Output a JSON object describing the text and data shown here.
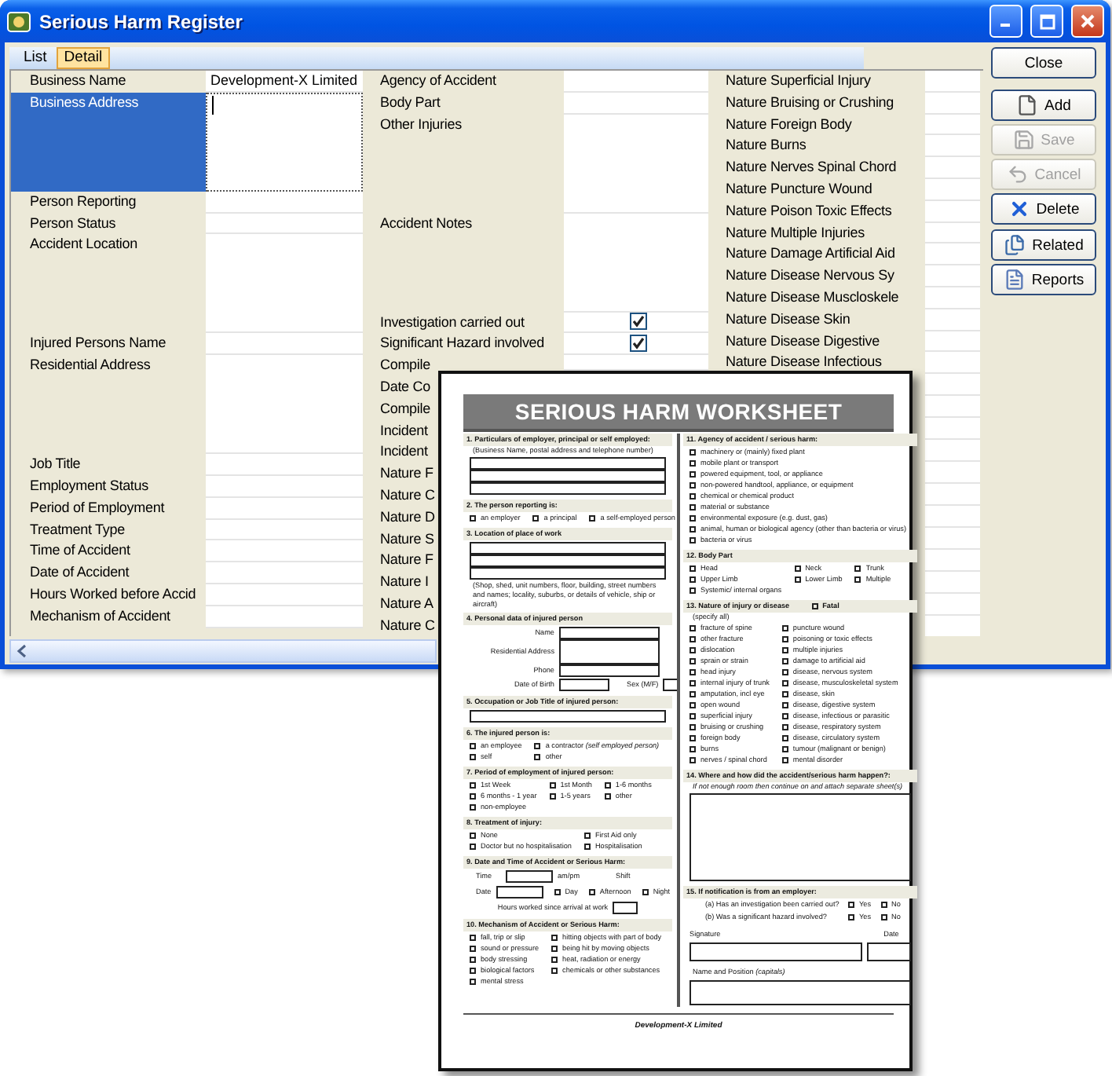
{
  "window": {
    "title": "Serious Harm Register"
  },
  "tabs": [
    {
      "label": "List",
      "selected": false
    },
    {
      "label": "Detail",
      "selected": true
    }
  ],
  "columns": [
    {
      "fields": [
        {
          "label": "Business Name",
          "value": "Development-X Limited",
          "kind": "text",
          "selected": false
        },
        {
          "label": "Business Address",
          "kind": "multiline",
          "selected": true
        },
        {
          "label": "Person Reporting",
          "kind": "text",
          "selected": false
        },
        {
          "label": "Person Status",
          "kind": "text",
          "selected": false
        },
        {
          "label": "Accident Location",
          "kind": "multiline",
          "selected": false
        },
        {
          "label": "Injured Persons Name",
          "kind": "text",
          "selected": false
        },
        {
          "label": "Residential Address",
          "kind": "multiline",
          "selected": false
        },
        {
          "label": "Job Title",
          "kind": "text",
          "selected": false
        },
        {
          "label": "Employment Status",
          "kind": "text",
          "selected": false
        },
        {
          "label": "Period of Employment",
          "kind": "text",
          "selected": false
        },
        {
          "label": "Treatment Type",
          "kind": "text",
          "selected": false
        },
        {
          "label": "Time of Accident",
          "kind": "text",
          "selected": false
        },
        {
          "label": "Date of Accident",
          "kind": "text",
          "selected": false
        },
        {
          "label": "Hours Worked before Accid",
          "kind": "text",
          "selected": false
        },
        {
          "label": "Mechanism of Accident",
          "kind": "text",
          "selected": false
        }
      ]
    },
    {
      "fields": [
        {
          "label": "Agency of Accident",
          "kind": "text"
        },
        {
          "label": "Body Part",
          "kind": "text"
        },
        {
          "label": "Other Injuries",
          "kind": "multiline"
        },
        {
          "label": "Accident Notes",
          "kind": "multiline"
        },
        {
          "label": "Investigation carried out",
          "kind": "checkbox",
          "checked": true
        },
        {
          "label": "Significant Hazard involved",
          "kind": "checkbox",
          "checked": true
        },
        {
          "label": "Compile",
          "kind": "text"
        },
        {
          "label": "Date Co",
          "kind": "text"
        },
        {
          "label": "Compile",
          "kind": "text"
        },
        {
          "label": "Incident",
          "kind": "text"
        },
        {
          "label": "Incident",
          "kind": "text"
        },
        {
          "label": "Nature F",
          "kind": "text"
        },
        {
          "label": "Nature C",
          "kind": "text"
        },
        {
          "label": "Nature D",
          "kind": "text"
        },
        {
          "label": "Nature S",
          "kind": "text"
        },
        {
          "label": "Nature F",
          "kind": "text"
        },
        {
          "label": "Nature I",
          "kind": "text"
        },
        {
          "label": "Nature A",
          "kind": "text"
        },
        {
          "label": "Nature C",
          "kind": "text"
        }
      ]
    },
    {
      "fields": [
        {
          "label": "Nature Superficial Injury",
          "kind": "text"
        },
        {
          "label": "Nature Bruising or Crushing",
          "kind": "text"
        },
        {
          "label": "Nature Foreign Body",
          "kind": "text"
        },
        {
          "label": "Nature Burns",
          "kind": "text"
        },
        {
          "label": "Nature Nerves Spinal Chord",
          "kind": "text"
        },
        {
          "label": "Nature Puncture Wound",
          "kind": "text"
        },
        {
          "label": "Nature Poison Toxic Effects",
          "kind": "text"
        },
        {
          "label": "Nature Multiple Injuries",
          "kind": "text"
        },
        {
          "label": "Nature Damage Artificial Aid",
          "kind": "text"
        },
        {
          "label": "Nature Disease Nervous Sy",
          "kind": "text"
        },
        {
          "label": "Nature Disease Muscloskele",
          "kind": "text"
        },
        {
          "label": "Nature Disease Skin",
          "kind": "text"
        },
        {
          "label": "Nature Disease Digestive",
          "kind": "text"
        },
        {
          "label": "Nature Disease Infectious",
          "kind": "text"
        }
      ]
    }
  ],
  "buttons": [
    {
      "label": "Close",
      "disabled": false
    },
    {
      "label": "Add",
      "disabled": false
    },
    {
      "label": "Save",
      "disabled": true
    },
    {
      "label": "Cancel",
      "disabled": true
    },
    {
      "label": "Delete",
      "disabled": false
    },
    {
      "label": "Related",
      "disabled": false
    },
    {
      "label": "Reports",
      "disabled": false
    }
  ],
  "worksheet": {
    "title": "SERIOUS HARM WORKSHEET",
    "left_sections": [
      {
        "kind": "boxes",
        "heading": "1. Particulars of employer, principal or self employed:",
        "note": "(Business Name, postal address and telephone number)"
      },
      {
        "kind": "options",
        "heading": "2. The person reporting is:",
        "rows": [
          [
            "an employer",
            "a principal",
            "a self-employed person"
          ]
        ]
      },
      {
        "kind": "boxes",
        "heading": "3. Location of place of work",
        "after_note": "(Shop, shed, unit numbers, floor, building, street numbers and names; locality, suburbs, or details of vehicle, ship or aircraft)"
      },
      {
        "kind": "person",
        "heading": "4. Personal data of injured person",
        "fields": [
          {
            "label": "Name",
            "kind": "line"
          },
          {
            "label": "Residential Address",
            "kind": "tall"
          },
          {
            "label": "Phone",
            "kind": "line"
          }
        ],
        "dob": "Date of Birth",
        "sex": "Sex (M/F)"
      },
      {
        "kind": "box",
        "heading": "5. Occupation or Job Title of injured person:"
      },
      {
        "kind": "options",
        "heading": "6. The injured person is:",
        "rows": [
          [
            "an employee",
            "a contractor *(self employed person)*"
          ],
          [
            "self",
            "other"
          ]
        ]
      },
      {
        "kind": "options",
        "heading": "7. Period of employment of injured person:",
        "rows": [
          [
            "1st Week",
            "1st Month",
            "1-6 months"
          ],
          [
            "6 months - 1 year",
            "1-5 years",
            "other"
          ],
          [
            "non-employee"
          ]
        ]
      },
      {
        "kind": "options",
        "heading": "8. Treatment of injury:",
        "rows": [
          [
            "None",
            "First Aid only"
          ],
          [
            "Doctor but no hospitalisation",
            "Hospitalisation"
          ]
        ]
      },
      {
        "kind": "datetime",
        "heading": "9. Date and Time of Accident or Serious Harm:",
        "time": "Time",
        "ampm": "am/pm",
        "shift": "Shift",
        "date": "Date",
        "shifts": [
          "Day",
          "Afternoon",
          "Night"
        ],
        "hours": "Hours worked since arrival at work"
      },
      {
        "kind": "options",
        "heading": "10. Mechanism of Accident or Serious Harm:",
        "rows": [
          [
            "fall, trip or slip",
            "hitting objects with part of body"
          ],
          [
            "sound or pressure",
            "being hit by moving objects"
          ],
          [
            "body stressing",
            "heat, radiation or energy"
          ],
          [
            "biological factors",
            "chemicals or other substances"
          ],
          [
            "mental stress"
          ]
        ]
      }
    ],
    "right_sections": [
      {
        "kind": "options",
        "heading": "11. Agency of accident / serious harm:",
        "rows": [
          [
            "machinery or (mainly) fixed plant"
          ],
          [
            "mobile plant or transport"
          ],
          [
            "powered equipment, tool, or appliance"
          ],
          [
            "non-powered handtool, appliance, or equipment"
          ],
          [
            "chemical or chemical product"
          ],
          [
            "material or substance"
          ],
          [
            "environmental exposure (e.g. dust, gas)"
          ],
          [
            "animal, human or biological agency (other than bacteria or virus)"
          ],
          [
            "bacteria or virus"
          ]
        ]
      },
      {
        "kind": "options",
        "heading": "12. Body Part",
        "rows": [
          [
            "Head",
            "Neck",
            "Trunk"
          ],
          [
            "Upper Limb",
            "Lower Limb",
            "Multiple"
          ],
          [
            "Systemic/ internal organs"
          ]
        ]
      },
      {
        "kind": "options",
        "heading": "13. Nature of injury or disease",
        "heading_option": "Fatal",
        "note": "(specify all)",
        "rows": [
          [
            "fracture of spine",
            "puncture wound"
          ],
          [
            "other fracture",
            "poisoning or toxic effects"
          ],
          [
            "dislocation",
            "multiple injuries"
          ],
          [
            "sprain or strain",
            "damage to artificial aid"
          ],
          [
            "head injury",
            "disease, nervous system"
          ],
          [
            "internal injury of trunk",
            "disease, musculoskeletal system"
          ],
          [
            "amputation, incl eye",
            "disease, skin"
          ],
          [
            "open wound",
            "disease, digestive system"
          ],
          [
            "superficial injury",
            "disease, infectious or parasitic"
          ],
          [
            "bruising or crushing",
            "disease, respiratory system"
          ],
          [
            "foreign body",
            "disease, circulatory system"
          ],
          [
            "burns",
            "tumour (malignant or benign)"
          ],
          [
            "nerves / spinal chord",
            "mental disorder"
          ]
        ]
      },
      {
        "kind": "narrative",
        "heading": "14. Where and how did the accident/serious harm happen?:",
        "note": "If not enough room then continue on and attach separate sheet(s)"
      },
      {
        "kind": "notification",
        "heading": "15. If notification is from an employer:",
        "questions": [
          {
            "text": "(a) Has an investigation been carried out?",
            "options": [
              "Yes",
              "No"
            ]
          },
          {
            "text": "(b) Was a significant hazard involved?",
            "options": [
              "Yes",
              "No"
            ]
          }
        ],
        "signature": "Signature",
        "date": "Date",
        "name": "Name and Position *(capitals)*"
      }
    ],
    "footer": "Development-X Limited"
  }
}
